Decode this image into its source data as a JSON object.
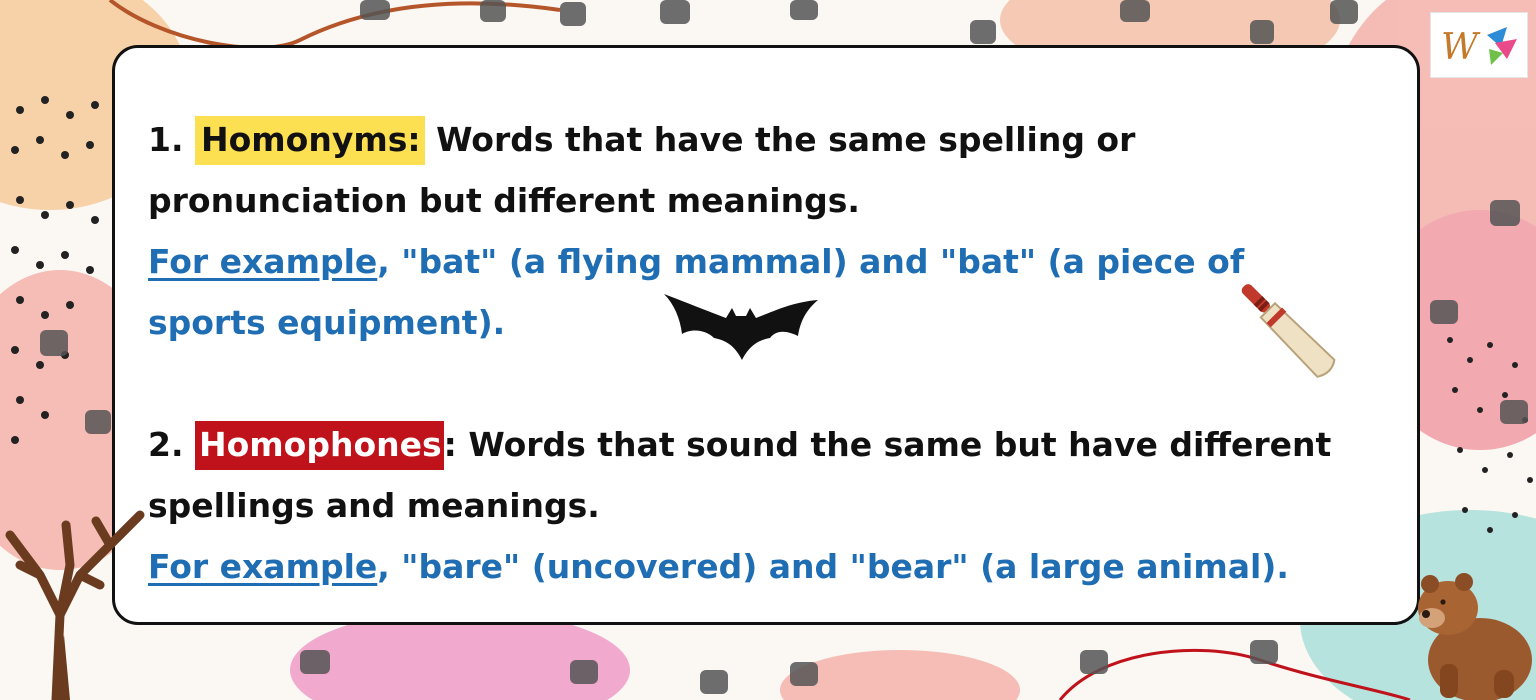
{
  "section1": {
    "number": "1.",
    "term": "Homonyms:",
    "definition_line1": "Words that have the same spelling or",
    "definition_line2": "pronunciation but different meanings.",
    "example_label": "For example",
    "example_line1": ", \"bat\" (a flying mammal) and \"bat\" (a piece of",
    "example_line2": "sports equipment)."
  },
  "section2": {
    "number": "2.",
    "term": "Homophones",
    "colon": ":",
    "definition_line1": "Words that sound the same but have different",
    "definition_line2": "spellings and meanings.",
    "example_label": "For example",
    "example_line1": ", \"bare\" (uncovered) and \"bear\" (a large animal)."
  },
  "colors": {
    "highlight_yellow": "#fddf52",
    "highlight_red": "#c0121b",
    "example_blue": "#1f6db3"
  },
  "logo": {
    "letter": "W"
  },
  "icons": [
    "bat-animal-icon",
    "cricket-bat-icon",
    "bear-icon",
    "tree-icon",
    "logo-icon"
  ]
}
